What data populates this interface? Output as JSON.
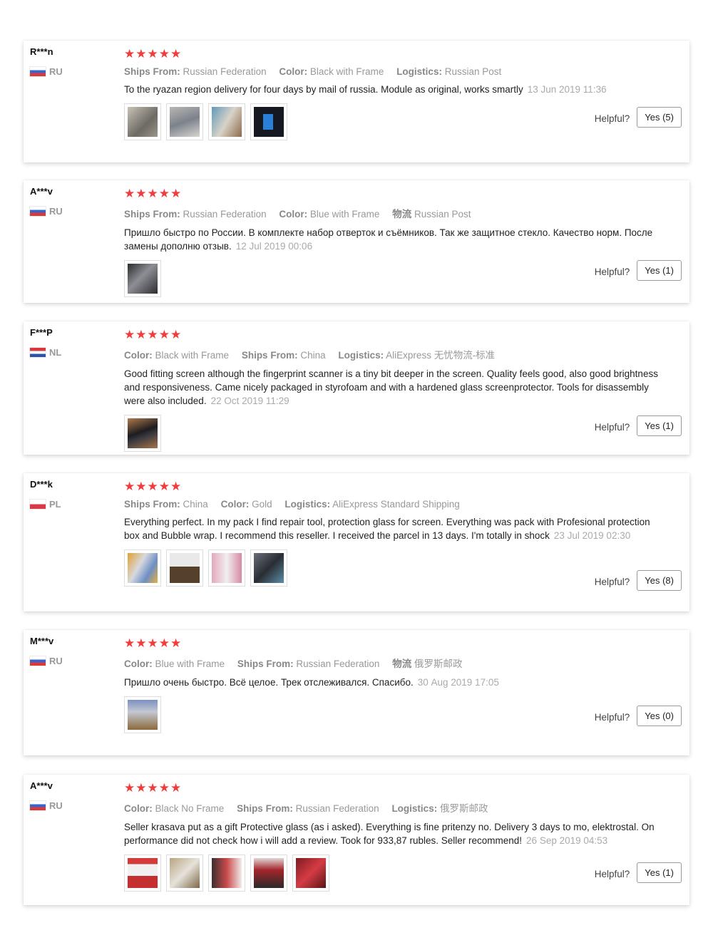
{
  "helpful_label": "Helpful?",
  "reviews": [
    {
      "user": "R***n",
      "country": "RU",
      "flag": "ru",
      "stars": "★★★★★",
      "meta": [
        {
          "k": "Ships From:",
          "v": "Russian Federation"
        },
        {
          "k": "Color:",
          "v": "Black with Frame"
        },
        {
          "k": "Logistics:",
          "v": "Russian Post"
        }
      ],
      "text": "To the ryazan region delivery for four days by mail of russia. Module as original, works smartly",
      "date": "13 Jun 2019 11:36",
      "helpful": "Yes (5)",
      "photos": [
        "photo-1",
        "photo-2",
        "photo-3",
        "photo-4"
      ]
    },
    {
      "user": "A***v",
      "country": "RU",
      "flag": "ru",
      "stars": "★★★★★",
      "meta": [
        {
          "k": "Ships From:",
          "v": "Russian Federation"
        },
        {
          "k": "Color:",
          "v": "Blue with Frame"
        },
        {
          "k": "物流",
          "v": "Russian Post"
        }
      ],
      "text": "Пришло быстро по России. В комплекте набор отверток и съёмников. Так же защитное стекло. Качество норм. После замены дополню отзыв.",
      "date": "12 Jul 2019 00:06",
      "helpful": "Yes (1)",
      "photos": [
        "photo-1"
      ]
    },
    {
      "user": "F***P",
      "country": "NL",
      "flag": "nl",
      "stars": "★★★★★",
      "meta": [
        {
          "k": "Color:",
          "v": "Black with Frame"
        },
        {
          "k": "Ships From:",
          "v": "China"
        },
        {
          "k": "Logistics:",
          "v": "AliExpress 无忧物流-标准"
        }
      ],
      "text": "Good fitting screen although the fingerprint scanner is a tiny bit deeper in the screen. Quality feels good, also good brightness and responsiveness. Came nicely packaged in styrofoam and with a hardened glass screenprotector. Tools for disassembly were also included.",
      "date": "22 Oct 2019 11:29",
      "helpful": "Yes (1)",
      "photos": [
        "photo-1"
      ]
    },
    {
      "user": "D***k",
      "country": "PL",
      "flag": "pl",
      "stars": "★★★★★",
      "meta": [
        {
          "k": "Ships From:",
          "v": "China"
        },
        {
          "k": "Color:",
          "v": "Gold"
        },
        {
          "k": "Logistics:",
          "v": "AliExpress Standard Shipping"
        }
      ],
      "text": "Everything perfect. In my pack I find repair tool, protection glass for screen. Everything was pack with Profesional protection box and Bubble wrap. I recommend this reseller. I received the parcel in 13 days. I'm totally in shock",
      "date": "23 Jul 2019 02:30",
      "helpful": "Yes (8)",
      "photos": [
        "photo-1",
        "photo-2",
        "photo-3",
        "photo-4"
      ]
    },
    {
      "user": "M***v",
      "country": "RU",
      "flag": "ru",
      "stars": "★★★★★",
      "meta": [
        {
          "k": "Color:",
          "v": "Blue with Frame"
        },
        {
          "k": "Ships From:",
          "v": "Russian Federation"
        },
        {
          "k": "物流",
          "v": "俄罗斯邮政"
        }
      ],
      "text": "Пришло очень быстро. Всё целое. Трек отслеживался. Спасибо.",
      "date": "30 Aug 2019 17:05",
      "helpful": "Yes (0)",
      "photos": [
        "photo-1"
      ]
    },
    {
      "user": "A***v",
      "country": "RU",
      "flag": "ru",
      "stars": "★★★★★",
      "meta": [
        {
          "k": "Color:",
          "v": "Black No Frame"
        },
        {
          "k": "Ships From:",
          "v": "Russian Federation"
        },
        {
          "k": "Logistics:",
          "v": "俄罗斯邮政"
        }
      ],
      "text": "Seller krasava put as a gift Protective glass (as i asked). Everything is fine pritenzy no. Delivery 3 days to mo, elektrostal. On performance did not check how i will add a review. Took for 933,87 rubles. Seller recommend!",
      "date": "26 Sep 2019 04:53",
      "helpful": "Yes (1)",
      "photos": [
        "photo-1",
        "photo-2",
        "photo-3",
        "photo-4",
        "photo-5"
      ]
    }
  ]
}
